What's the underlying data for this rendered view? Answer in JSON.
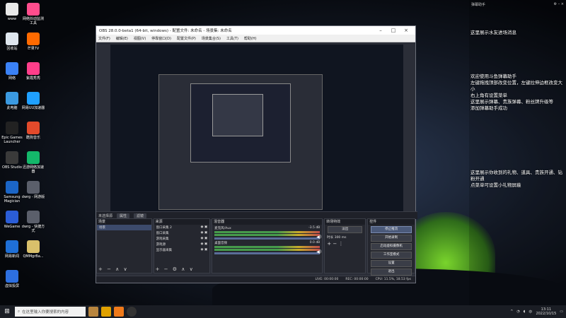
{
  "desktop": {
    "icons": [
      {
        "label": "www",
        "color": "#e8e8e8"
      },
      {
        "label": "网络抖动监测工具",
        "color": "#ff4d8d"
      },
      {
        "label": "回收站",
        "color": "#dfe6ee"
      },
      {
        "label": "芒果TV",
        "color": "#ff6a00"
      },
      {
        "label": "网络",
        "color": "#3b82f6"
      },
      {
        "label": "紫霞秀秀",
        "color": "#ff3e8a"
      },
      {
        "label": "此电脑",
        "color": "#3b9ae1"
      },
      {
        "label": "网易UU加速器",
        "color": "#1fa0ff"
      },
      {
        "label": "Epic Games Launcher",
        "color": "#222222"
      },
      {
        "label": "酷狗音乐",
        "color": "#e24a2b"
      },
      {
        "label": "OBS Studio",
        "color": "#3a3a3a"
      },
      {
        "label": "迅游网络加速器",
        "color": "#14b86a"
      },
      {
        "label": "Samsung Magician",
        "color": "#1b65c6"
      },
      {
        "label": "dwrg - 网游版",
        "color": "#5b5f6b"
      },
      {
        "label": "WeGame",
        "color": "#2b5dd6"
      },
      {
        "label": "dwrg - 快捷方式",
        "color": "#5b5f6b"
      },
      {
        "label": "网易新闻",
        "color": "#1f6fd6"
      },
      {
        "label": "QMMgrBa...",
        "color": "#d9c06b"
      },
      {
        "label": "虚拟投屏",
        "color": "#2d6fe0"
      }
    ]
  },
  "obs": {
    "title": "OBS 28.0.0-beta1 (64-bit, windows) - 配置文件: 未命名 - 场景集: 未命名",
    "menu": [
      "文件(F)",
      "编辑(E)",
      "视图(V)",
      "停靠窗口(D)",
      "配置文件(P)",
      "场景集合(S)",
      "工具(T)",
      "帮助(H)"
    ],
    "scene_label": "未选择源",
    "scene_buttons": [
      "属性",
      "滤镜"
    ],
    "docks": {
      "scenes": {
        "title": "场景",
        "items": [
          "场景"
        ]
      },
      "sources": {
        "title": "来源",
        "items": [
          "窗口采集 2",
          "窗口采集",
          "游戏采集",
          "游戏源",
          "显示器采集"
        ]
      },
      "mixer": {
        "title": "混音器",
        "channels": [
          {
            "name": "麦克风/Aux",
            "db": "-3.5 dB"
          },
          {
            "name": "桌面音频",
            "db": "0.0 dB"
          }
        ]
      },
      "transitions": {
        "title": "转场特效",
        "type": "淡出",
        "duration_label": "时长",
        "duration": "300 ms"
      },
      "controls": {
        "title": "控件",
        "buttons": [
          "停止推流",
          "开始录制",
          "启动虚拟摄像机",
          "工作室模式",
          "设置",
          "退出"
        ]
      }
    },
    "status": {
      "live": "LIVE: 00:00:00",
      "rec": "REC: 00:00:00",
      "cpu": "CPU: 11.5%, 18.53 fps"
    }
  },
  "chat": {
    "header_title": "弹幕助手",
    "messages": [
      "这里展示水友进场消息",
      "欢迎使用斗鱼弹幕助手\n左键拖拽顶部改变位置，左键拉伸边框改变大小\n右上角有设置菜单\n这里展示弹幕、贵族弹幕、粉丝牌升级等\n添加弹幕助手成功",
      "这里展示你收到的礼物、道具、贵族开通、钻粉开通\n点菜单可设置小礼物屏蔽"
    ]
  },
  "taskbar": {
    "search_placeholder": "在这里输入你要搜索的内容",
    "time": "13:11",
    "date": "2022/10/15",
    "ime": "中"
  }
}
